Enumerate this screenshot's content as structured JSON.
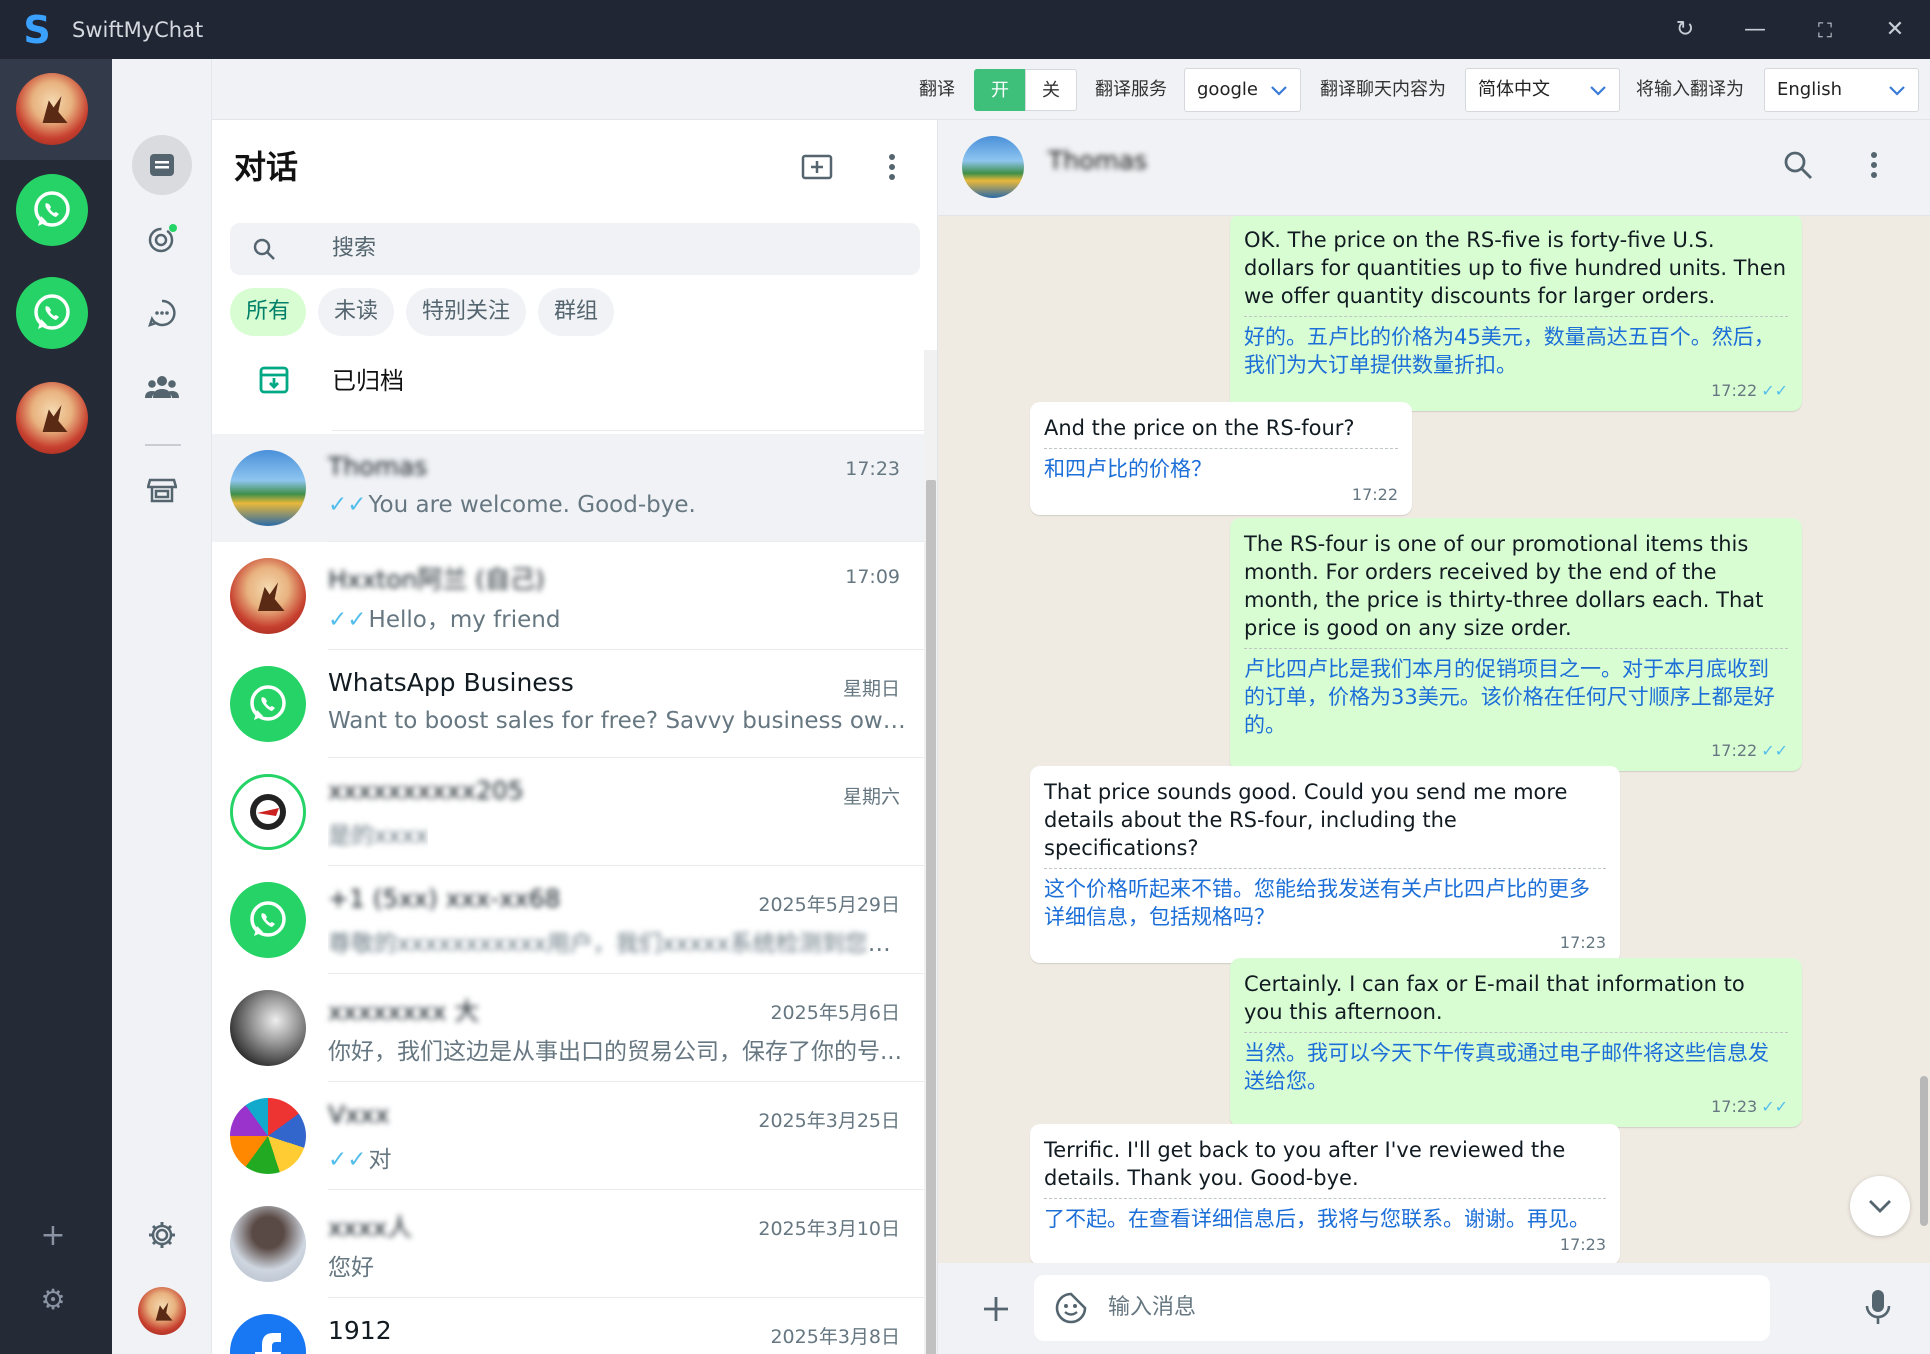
{
  "app": {
    "title": "SwiftMyChat",
    "logo_letter": "S"
  },
  "window": {
    "refresh": "↻",
    "minimize": "—",
    "maximize": "⛶",
    "close": "✕"
  },
  "toolbar": {
    "translate_label": "翻译",
    "on_label": "开",
    "off_label": "关",
    "service_label": "翻译服务",
    "service_value": "google",
    "chat_translate_label": "翻译聊天内容为",
    "chat_translate_value": "简体中文",
    "input_translate_label": "将输入翻译为",
    "input_translate_value": "English",
    "accent_color": "#3ec07b"
  },
  "rail": {
    "add": "+",
    "settings": "⚙"
  },
  "list": {
    "title": "对话",
    "search_placeholder": "搜索",
    "chips": [
      "所有",
      "未读",
      "特别关注",
      "群组"
    ],
    "archived_label": "已归档",
    "chats": [
      {
        "name": "Thomas",
        "time": "17:23",
        "preview": "You are welcome. Good-bye.",
        "ticks": true,
        "avatar": "landscape",
        "blur_name": true
      },
      {
        "name": "Hxxton阿兰 (自己)",
        "time": "17:09",
        "preview": "Hello，my friend",
        "ticks": true,
        "avatar": "red",
        "blur_name": true
      },
      {
        "name": "WhatsApp Business",
        "time": "星期日",
        "preview": "Want to boost sales for free? Savvy business owne...",
        "ticks": false,
        "avatar": "wa",
        "blur_name": false
      },
      {
        "name": "xxxxxxxxxx205",
        "time": "星期六",
        "preview": "是的xxxx",
        "ticks": false,
        "avatar": "logo",
        "blur_name": true
      },
      {
        "name": "+1 (5xx) xxx-xx68",
        "time": "2025年5月29日",
        "preview": "尊敬的xxxxxxxxxxx用户，我们xxxxx系统检测到您目前...",
        "ticks": false,
        "avatar": "wa",
        "blur_name": true
      },
      {
        "name": "xxxxxxxx 大",
        "time": "2025年5月6日",
        "preview": "你好，我们这边是从事出口的贸易公司，保存了你的号...",
        "ticks": false,
        "avatar": "dark",
        "blur_name": true
      },
      {
        "name": "Vxxx",
        "time": "2025年3月25日",
        "preview": "对",
        "ticks": true,
        "avatar": "pencils",
        "blur_name": true
      },
      {
        "name": "xxxx人",
        "time": "2025年3月10日",
        "preview": "您好",
        "ticks": false,
        "avatar": "woman",
        "blur_name": true
      },
      {
        "name": "1912",
        "time": "2025年3月8日",
        "preview": "",
        "ticks": false,
        "avatar": "fb",
        "blur_name": false
      }
    ]
  },
  "conversation": {
    "contact_name": "Thomas",
    "input_placeholder": "输入消息",
    "messages": [
      {
        "dir": "out",
        "en": "OK. The price on the RS-five is forty-five U.S. dollars for quantities up to five hundred units. Then we offer quantity discounts for larger orders.",
        "zh": "好的。五卢比的价格为45美元，数量高达五百个。然后，我们为大订单提供数量折扣。",
        "time": "17:22",
        "ticks": "✓✓"
      },
      {
        "dir": "in",
        "en": "And the price on the RS-four?",
        "zh": "和四卢比的价格？",
        "time": "17:22",
        "ticks": ""
      },
      {
        "dir": "out",
        "en": "The RS-four is one of our promotional items this month. For orders received by the end of the month, the price is thirty-three dollars each. That price is good on any size order.",
        "zh": "卢比四卢比是我们本月的促销项目之一。对于本月底收到的订单，价格为33美元。该价格在任何尺寸顺序上都是好的。",
        "time": "17:22",
        "ticks": "✓✓"
      },
      {
        "dir": "in",
        "en": "That price sounds good. Could you send me more details about the RS-four, including the specifications?",
        "zh": "这个价格听起来不错。您能给我发送有关卢比四卢比的更多详细信息，包括规格吗？",
        "time": "17:23",
        "ticks": ""
      },
      {
        "dir": "out",
        "en": "Certainly. I can fax or E-mail that information to you this afternoon.",
        "zh": "当然。我可以今天下午传真或通过电子邮件将这些信息发送给您。",
        "time": "17:23",
        "ticks": "✓✓"
      },
      {
        "dir": "in",
        "en": "Terrific. I'll get back to you after I've reviewed the details. Thank you. Good-bye.",
        "zh": "了不起。在查看详细信息后，我将与您联系。谢谢。再见。",
        "time": "17:23",
        "ticks": ""
      }
    ]
  }
}
